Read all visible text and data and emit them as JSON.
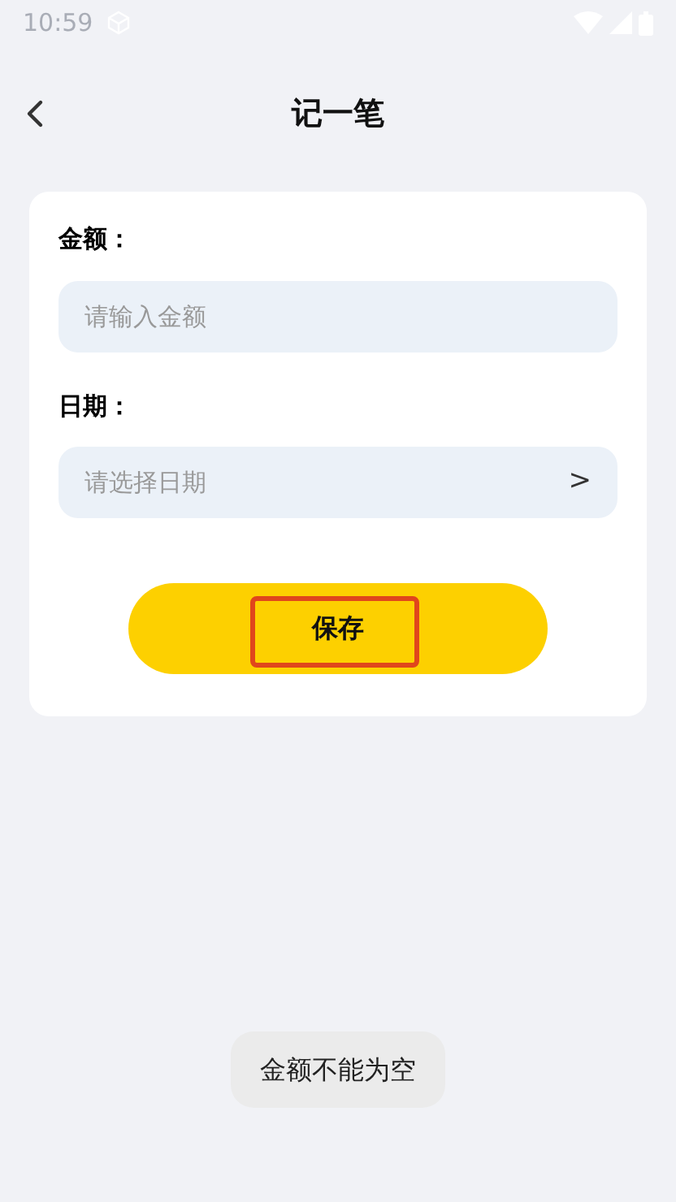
{
  "status_bar": {
    "time": "10:59"
  },
  "title": "记一笔",
  "fields": [
    {
      "kind": "input",
      "label": "金额：",
      "placeholder": "请输入金额"
    },
    {
      "kind": "picker",
      "label": "日期：",
      "placeholder": "请选择日期",
      "chevron": ">"
    }
  ],
  "save_button": {
    "label": "保存",
    "highlighted": true
  },
  "toast": "金额不能为空"
}
